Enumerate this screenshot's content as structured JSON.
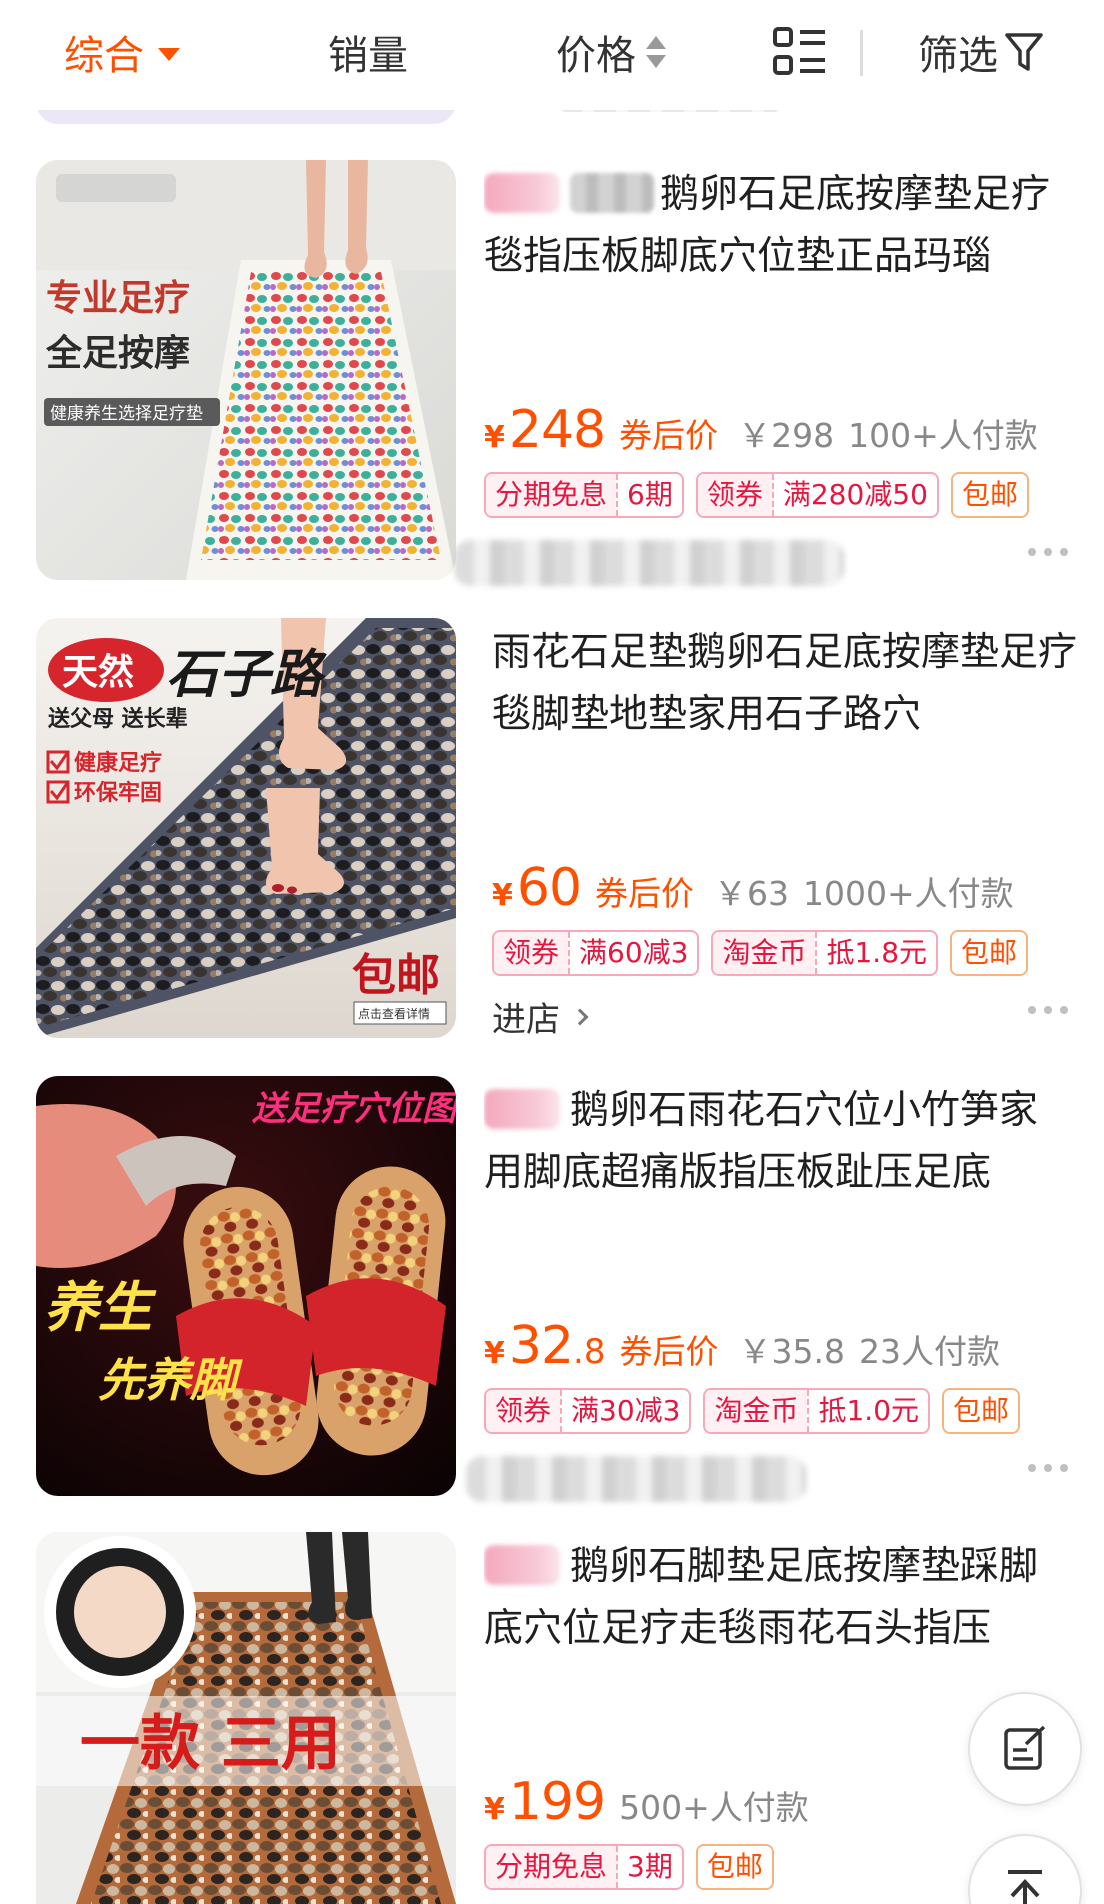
{
  "sortbar": {
    "composite": "综合",
    "sales": "销量",
    "price": "价格",
    "filter": "筛选"
  },
  "colors": {
    "accent": "#ff5000",
    "coupon": "#e6163f"
  },
  "products": [
    {
      "title": "鹅卵石足底按摩垫足疗毯指压板脚底穴位垫正品玛瑙",
      "image_text": {
        "line1": "专业足疗",
        "line2": "全足按摩",
        "line3": "健康养生选择足疗垫"
      },
      "price_int": "248",
      "after_coupon": "券后价",
      "orig_price": "￥298",
      "sold": "100+人付款",
      "tags": [
        [
          "分期免息",
          "6期"
        ],
        [
          "领券",
          "满280减50"
        ],
        [
          "包邮"
        ]
      ]
    },
    {
      "title": "雨花石足垫鹅卵石足底按摩垫足疗毯脚垫地垫家用石子路穴",
      "image_text": {
        "badge": "天然",
        "head": "石子路",
        "sub": "送父母  送长辈",
        "check1": "健康足疗",
        "check2": "环保牢固",
        "free": "包邮",
        "detail": "点击查看详情"
      },
      "price_int": "60",
      "after_coupon": "券后价",
      "orig_price": "￥63",
      "sold": "1000+人付款",
      "tags": [
        [
          "领券",
          "满60减3"
        ],
        [
          "淘金币",
          "抵1.8元"
        ],
        [
          "包邮"
        ]
      ],
      "shop": "进店"
    },
    {
      "title": "鹅卵石雨花石穴位小竹笋家用脚底超痛版指压板趾压足底",
      "image_text": {
        "send": "送足疗穴位图",
        "slogan1": "养生",
        "slogan2": "先养脚"
      },
      "price_int": "32",
      "price_dec": ".8",
      "after_coupon": "券后价",
      "orig_price": "￥35.8",
      "sold": "23人付款",
      "tags": [
        [
          "领券",
          "满30减3"
        ],
        [
          "淘金币",
          "抵1.0元"
        ],
        [
          "包邮"
        ]
      ]
    },
    {
      "title": "鹅卵石脚垫足底按摩垫踩脚底穴位足疗走毯雨花石头指压",
      "image_text": {
        "banner": "一款 三用"
      },
      "price_int": "199",
      "sold": "500+人付款",
      "tags": [
        [
          "分期免息",
          "3期"
        ],
        [
          "包邮"
        ]
      ]
    }
  ],
  "currency": "¥",
  "icons": [
    "caret-down-icon",
    "sort-updown-icon",
    "list-view-icon",
    "filter-funnel-icon",
    "more-dots-icon",
    "chevron-right-icon",
    "edit-note-icon",
    "back-to-top-icon"
  ]
}
